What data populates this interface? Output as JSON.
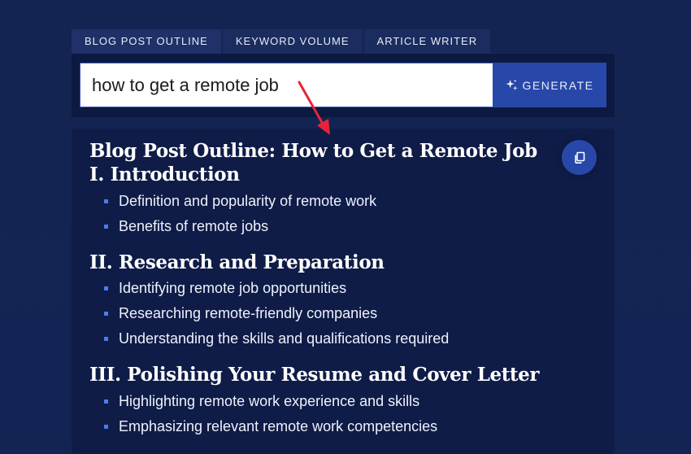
{
  "tabs": [
    {
      "label": "BLOG POST OUTLINE",
      "active": true
    },
    {
      "label": "KEYWORD VOLUME",
      "active": false
    },
    {
      "label": "ARTICLE WRITER",
      "active": false
    }
  ],
  "search": {
    "value": "how to get a remote job"
  },
  "generate": {
    "label": "GENERATE",
    "icon": "sparkle-icon"
  },
  "copy": {
    "icon": "copy-icon"
  },
  "outline": {
    "title": "Blog Post Outline: How to Get a Remote Job",
    "sections": [
      {
        "heading": "I. Introduction",
        "items": [
          "Definition and popularity of remote work",
          "Benefits of remote jobs"
        ]
      },
      {
        "heading": "II. Research and Preparation",
        "items": [
          "Identifying remote job opportunities",
          "Researching remote-friendly companies",
          "Understanding the skills and qualifications required"
        ]
      },
      {
        "heading": "III. Polishing Your Resume and Cover Letter",
        "items": [
          "Highlighting remote work experience and skills",
          "Emphasizing relevant remote work competencies"
        ]
      }
    ]
  },
  "colors": {
    "background": "#142452",
    "accent": "#2748a8",
    "bullet": "#4a7cf0",
    "annotation_arrow": "#e8243a"
  }
}
